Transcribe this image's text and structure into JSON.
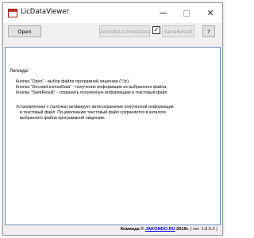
{
  "window": {
    "title": "LicDataViewer",
    "close_glyph": "✕"
  },
  "toolbar": {
    "open_label": "Open",
    "decode_label": "DecodeLicenseData",
    "checkbox_checked": true,
    "checkbox_glyph": "✓",
    "save_label": "SaveResult",
    "help_label": "?"
  },
  "content": {
    "legend_title": "Легенда:",
    "legend_lines": [
      "Кнопка \"Open\" - выбор файла програмной лицензии (*.lic).",
      "Кнопка \"DecodeLicenseData\" - получение информации из выбранного файла.",
      "Кнопка \"SaveResult\" - сохранить полученную информацию в текстовый файл."
    ],
    "note_lines": [
      "Установленная v (галочка) активирует автосохранение полученной информации",
      "в текстовый файл. По-умолчанию текстовый файл сохраняется в каталоге",
      "выбранного файла программной лицензии."
    ]
  },
  "status": {
    "prefix": "Команда ©",
    "link": "JAKONDO.RU",
    "year": "2019г.",
    "version": "( ver. 1.0.0.2 )"
  }
}
